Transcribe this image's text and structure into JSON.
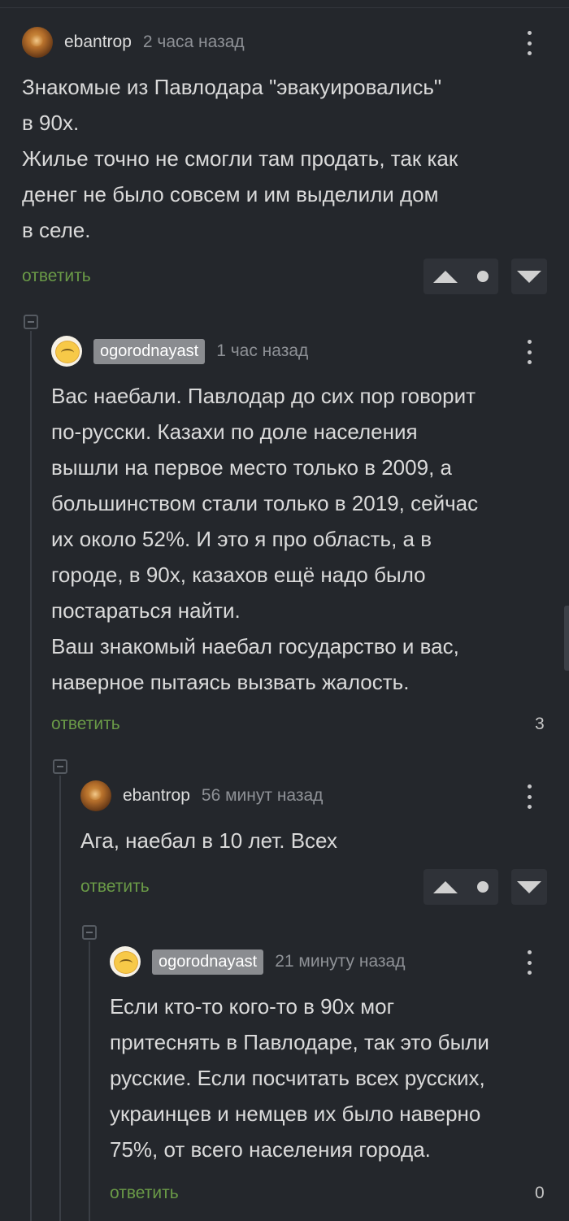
{
  "comments": [
    {
      "username": "ebantrop",
      "time": "2 часа назад",
      "text": "Знакомые из Павлодара \"эвакуировались\"\nв 90х.\nЖилье точно не смогли там продать, так как\nденег не было совсем и им выделили дом\nв селе.",
      "reply_label": "ответить"
    },
    {
      "username": "ogorodnayast",
      "time": "1 час назад",
      "text": "Вас наебали. Павлодар до сих пор говорит\nпо-русски. Казахи по доле населения\nвышли на первое место только в 2009, а\nбольшинством стали только в 2019, сейчас\nих около 52%. И это я про область, а в\nгороде, в 90х, казахов ещё надо было\nпостараться найти.\nВаш знакомый наебал государство и вас,\nнаверное пытаясь вызвать жалость.",
      "reply_label": "ответить",
      "rating": "3"
    },
    {
      "username": "ebantrop",
      "time": "56 минут назад",
      "text": "Ага, наебал в 10 лет. Всех",
      "reply_label": "ответить"
    },
    {
      "username": "ogorodnayast",
      "time": "21 минуту назад",
      "text": "Если кто-то кого-то в 90х мог\nпритеснять в Павлодаре, так это были\nрусские. Если посчитать всех русских,\nукраинцев и немцев их было наверно\n75%, от всего населения города.",
      "reply_label": "ответить",
      "rating": "0"
    }
  ],
  "icons": {
    "more": "more-vertical-icon",
    "upvote": "upvote-arrow-icon",
    "downvote": "downvote-arrow-icon",
    "collapse": "collapse-minus-icon"
  },
  "colors": {
    "background": "#24272c",
    "reply_link": "#6a9a47",
    "username_tag_bg": "#8a8c90"
  }
}
